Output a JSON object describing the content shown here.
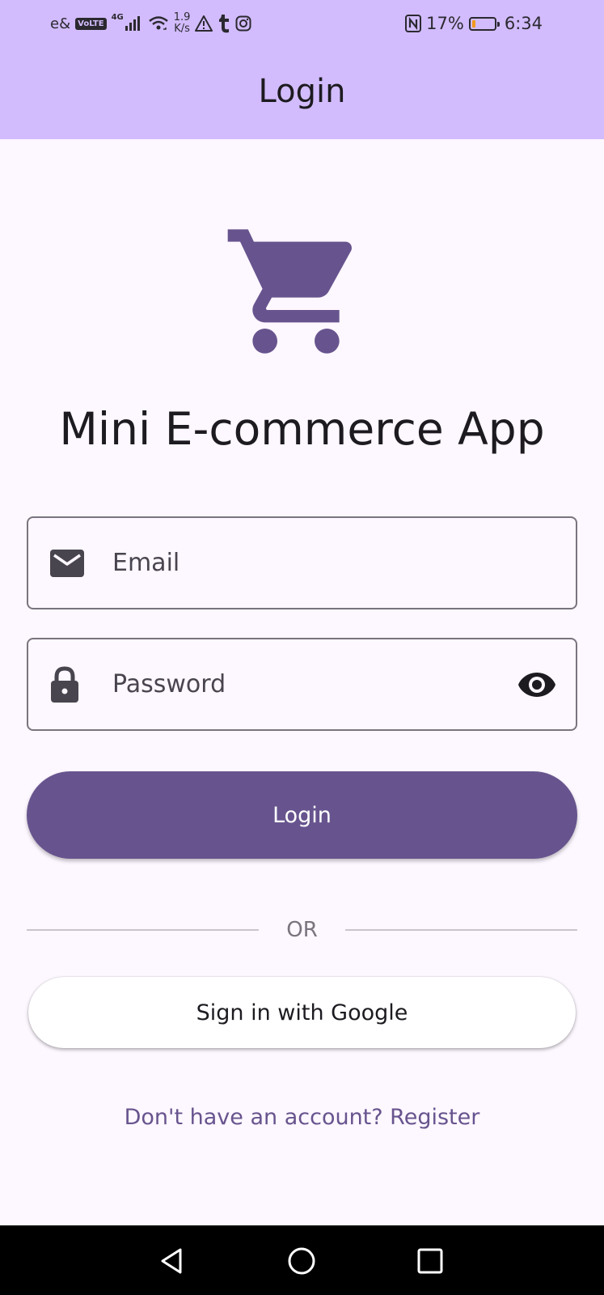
{
  "status_bar": {
    "carrier": "e&",
    "volte": "VoLTE",
    "network_type": "4G",
    "speed_value": "1.9",
    "speed_unit": "K/s",
    "battery_percent": "17%",
    "battery_level": 0.17,
    "time": "6:34",
    "icons": [
      "signal-icon",
      "wifi-icon",
      "warning-icon",
      "tumblr-icon",
      "instagram-icon",
      "nfc-icon",
      "battery-icon"
    ]
  },
  "app_bar": {
    "title": "Login"
  },
  "main": {
    "logo_icon": "shopping-cart-icon",
    "app_title": "Mini E-commerce App",
    "email_field": {
      "placeholder": "Email",
      "value": "",
      "icon": "email-icon"
    },
    "password_field": {
      "placeholder": "Password",
      "value": "",
      "icon": "lock-icon",
      "toggle_icon": "eye-icon"
    },
    "login_button": "Login",
    "divider_text": "OR",
    "google_button": "Sign in with Google",
    "register_link": "Don't have an account? Register"
  },
  "nav_bar": {
    "buttons": [
      "back-icon",
      "home-icon",
      "recents-icon"
    ]
  },
  "colors": {
    "app_bar": "#d2bcfd",
    "primary": "#67548e",
    "background": "#fdf7ff",
    "outline": "#79747e"
  }
}
